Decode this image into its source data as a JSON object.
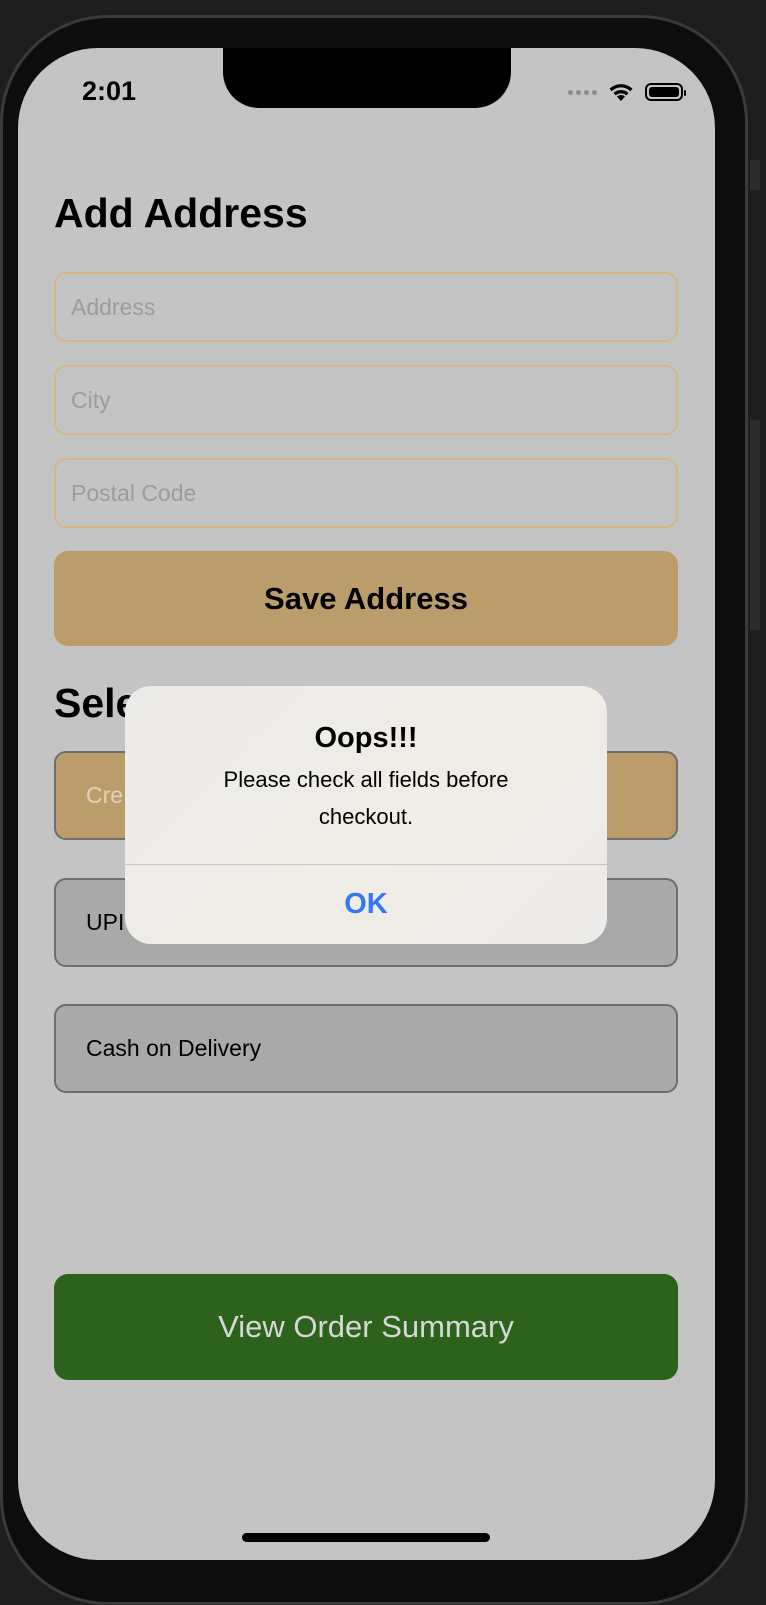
{
  "status_bar": {
    "time": "2:01"
  },
  "address_form": {
    "title": "Add Address",
    "address_placeholder": "Address",
    "address_value": "",
    "city_placeholder": "City",
    "city_value": "",
    "postal_placeholder": "Postal Code",
    "postal_value": "",
    "save_label": "Save Address"
  },
  "payment": {
    "title": "Sele",
    "options": [
      {
        "label": "Cre",
        "selected": true
      },
      {
        "label": "UPI",
        "selected": false
      },
      {
        "label": "Cash on Delivery",
        "selected": false
      }
    ]
  },
  "order_summary_label": "View Order Summary",
  "alert": {
    "title": "Oops!!!",
    "message": "Please check all fields before checkout.",
    "ok_label": "OK"
  },
  "colors": {
    "accent_tan": "#bb9d6b",
    "order_green": "#2c621b",
    "alert_blue": "#3478f6",
    "screen_dim": "#c4c4c4"
  }
}
